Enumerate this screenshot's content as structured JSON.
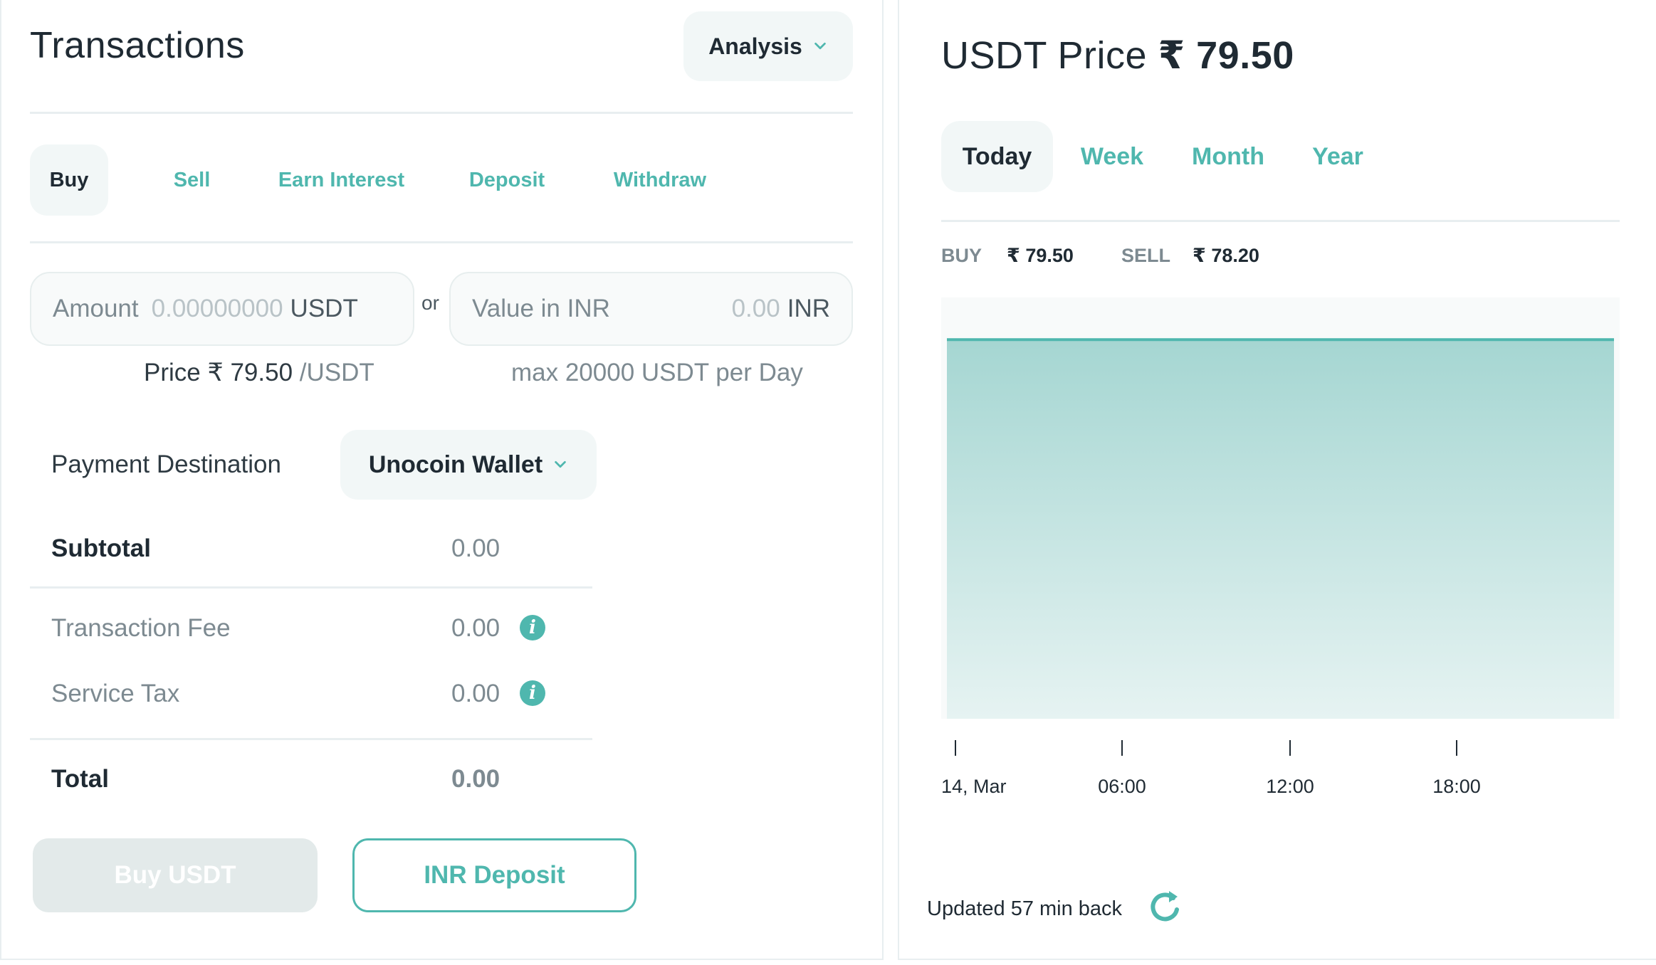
{
  "transactions": {
    "title": "Transactions",
    "analysis_label": "Analysis",
    "tabs": [
      {
        "label": "Buy",
        "active": true
      },
      {
        "label": "Sell",
        "active": false
      },
      {
        "label": "Earn Interest",
        "active": false
      },
      {
        "label": "Deposit",
        "active": false
      },
      {
        "label": "Withdraw",
        "active": false
      }
    ],
    "amount_field": {
      "label": "Amount",
      "placeholder": "0.00000000",
      "unit": "USDT"
    },
    "or_text": "or",
    "inr_field": {
      "label": "Value in INR",
      "placeholder": "0.00",
      "unit": "INR"
    },
    "price_note": {
      "prefix": "Price ₹ 79.50",
      "suffix": "/USDT"
    },
    "max_note": "max 20000 USDT per Day",
    "payment_destination": {
      "label": "Payment Destination",
      "value": "Unocoin Wallet"
    },
    "summary": {
      "subtotal_label": "Subtotal",
      "subtotal_value": "0.00",
      "fee_label": "Transaction Fee",
      "fee_value": "0.00",
      "tax_label": "Service Tax",
      "tax_value": "0.00",
      "total_label": "Total",
      "total_value": "0.00"
    },
    "buy_button": "Buy USDT",
    "deposit_button": "INR Deposit"
  },
  "price_panel": {
    "title_prefix": "USDT Price",
    "title_price": "₹ 79.50",
    "tabs": [
      {
        "label": "Today",
        "active": true
      },
      {
        "label": "Week",
        "active": false
      },
      {
        "label": "Month",
        "active": false
      },
      {
        "label": "Year",
        "active": false
      }
    ],
    "buy_key": "BUY",
    "buy_value": "₹ 79.50",
    "sell_key": "SELL",
    "sell_value": "₹ 78.20",
    "updated_text": "Updated 57 min back"
  },
  "colors": {
    "accent": "#4fb7ae",
    "text": "#1f2a33",
    "muted": "#7d8a91",
    "chart_fill_top": "#a5d6d2",
    "chart_fill_bottom": "#e6f3f2"
  },
  "chart_data": {
    "type": "area",
    "x_tick_labels": [
      "14, Mar",
      "06:00",
      "12:00",
      "18:00"
    ],
    "x": [
      "00:00",
      "23:59"
    ],
    "values": [
      79.5,
      79.5
    ],
    "grid": false
  }
}
